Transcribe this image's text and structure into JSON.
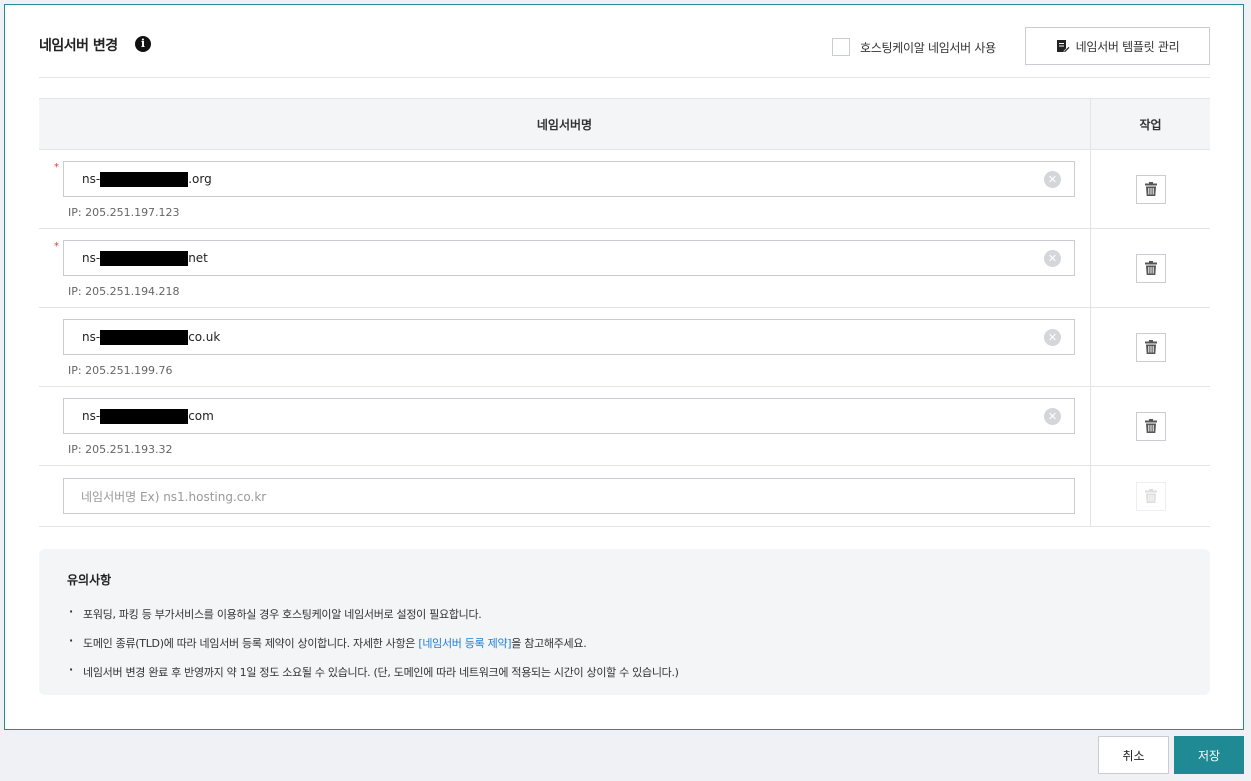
{
  "header": {
    "title": "네임서버 변경",
    "info_icon": "i",
    "hosting_checkbox_label": "호스팅케이알 네임서버 사용",
    "hosting_checkbox_checked": false,
    "template_button_label": "네임서버 템플릿 관리"
  },
  "table": {
    "col_name": "네임서버명",
    "col_action": "작업",
    "rows": [
      {
        "required": "*",
        "prefix": "ns-",
        "suffix": ".org",
        "ip": "IP: 205.251.197.123"
      },
      {
        "required": "*",
        "prefix": "ns-",
        "suffix": "net",
        "ip": "IP: 205.251.194.218"
      },
      {
        "required": "",
        "prefix": "ns-",
        "suffix": "co.uk",
        "ip": "IP: 205.251.199.76"
      },
      {
        "required": "",
        "prefix": "ns-",
        "suffix": "com",
        "ip": "IP: 205.251.193.32"
      }
    ],
    "new_row_placeholder": "네임서버명 Ex) ns1.hosting.co.kr"
  },
  "notice": {
    "title": "유의사항",
    "item1": "포워딩, 파킹 등 부가서비스를 이용하실 경우 호스팅케이알 네임서버로 설정이 필요합니다.",
    "item2_before": "도메인 종류(TLD)에 따라 네임서버 등록 제약이 상이합니다. 자세한 사항은 ",
    "item2_link": "[네임서버 등록 제약]",
    "item2_after": "을 참고해주세요.",
    "item3": "네임서버 변경 완료 후 반영까지 약 1일 정도 소요될 수 있습니다. (단, 도메인에 따라 네트워크에 적용되는 시간이 상이할 수 있습니다.)"
  },
  "footer": {
    "cancel_label": "취소",
    "save_label": "저장"
  },
  "colors": {
    "accent": "#1f8a94",
    "link": "#1b7fd6",
    "required": "#e0393e"
  },
  "icons": {
    "info": "info-icon",
    "template": "edit-document-icon",
    "clear": "clear-icon",
    "delete": "trash-icon"
  }
}
